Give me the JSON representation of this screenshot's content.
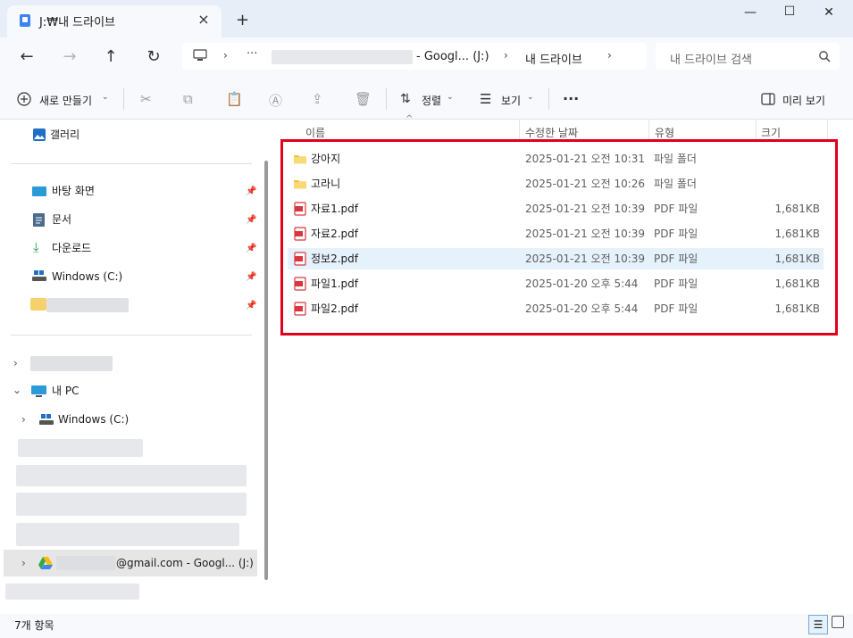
{
  "window": {
    "tab_title": "J:₩내 드라이브",
    "close_tab": "×",
    "new_tab": "+",
    "minimize": "—",
    "maximize": "☐",
    "close": "✕"
  },
  "nav": {
    "back": "←",
    "forward": "→",
    "up": "↑",
    "refresh": "↻",
    "address": {
      "more": "···",
      "drive_segment": "- Googl... (J:)",
      "current": "내 드라이브"
    },
    "search_placeholder": "내 드라이브 검색"
  },
  "toolbar": {
    "new_label": "새로 만들기",
    "sort_label": "정렬",
    "view_label": "보기",
    "more": "···",
    "preview_label": "미리 보기"
  },
  "sidebar": {
    "gallery": "갤러리",
    "quick": [
      {
        "label": "바탕 화면",
        "icon": "desktop-icon"
      },
      {
        "label": "문서",
        "icon": "document-icon"
      },
      {
        "label": "다운로드",
        "icon": "download-icon"
      },
      {
        "label": "Windows (C:)",
        "icon": "drive-icon"
      }
    ],
    "this_pc": "내 PC",
    "windows_c": "Windows (C:)",
    "gdrive_label": "@gmail.com - Googl... (J:)"
  },
  "columns": {
    "name": "이름",
    "date": "수정한 날짜",
    "type": "유형",
    "size": "크기"
  },
  "files": [
    {
      "name": "강아지",
      "date": "2025-01-21 오전 10:31",
      "type": "파일 폴더",
      "size": "",
      "kind": "folder"
    },
    {
      "name": "고라니",
      "date": "2025-01-21 오전 10:26",
      "type": "파일 폴더",
      "size": "",
      "kind": "folder"
    },
    {
      "name": "자료1.pdf",
      "date": "2025-01-21 오전 10:39",
      "type": "PDF 파일",
      "size": "1,681KB",
      "kind": "pdf"
    },
    {
      "name": "자료2.pdf",
      "date": "2025-01-21 오전 10:39",
      "type": "PDF 파일",
      "size": "1,681KB",
      "kind": "pdf"
    },
    {
      "name": "정보2.pdf",
      "date": "2025-01-21 오전 10:39",
      "type": "PDF 파일",
      "size": "1,681KB",
      "kind": "pdf"
    },
    {
      "name": "파일1.pdf",
      "date": "2025-01-20 오후 5:44",
      "type": "PDF 파일",
      "size": "1,681KB",
      "kind": "pdf"
    },
    {
      "name": "파일2.pdf",
      "date": "2025-01-20 오후 5:44",
      "type": "PDF 파일",
      "size": "1,681KB",
      "kind": "pdf"
    }
  ],
  "status": {
    "count": "7개 항목"
  },
  "colors": {
    "highlight": "#e0001b",
    "selected_row": "#e5f1fb",
    "folder": "#f4c430",
    "pdf": "#d9363e"
  }
}
